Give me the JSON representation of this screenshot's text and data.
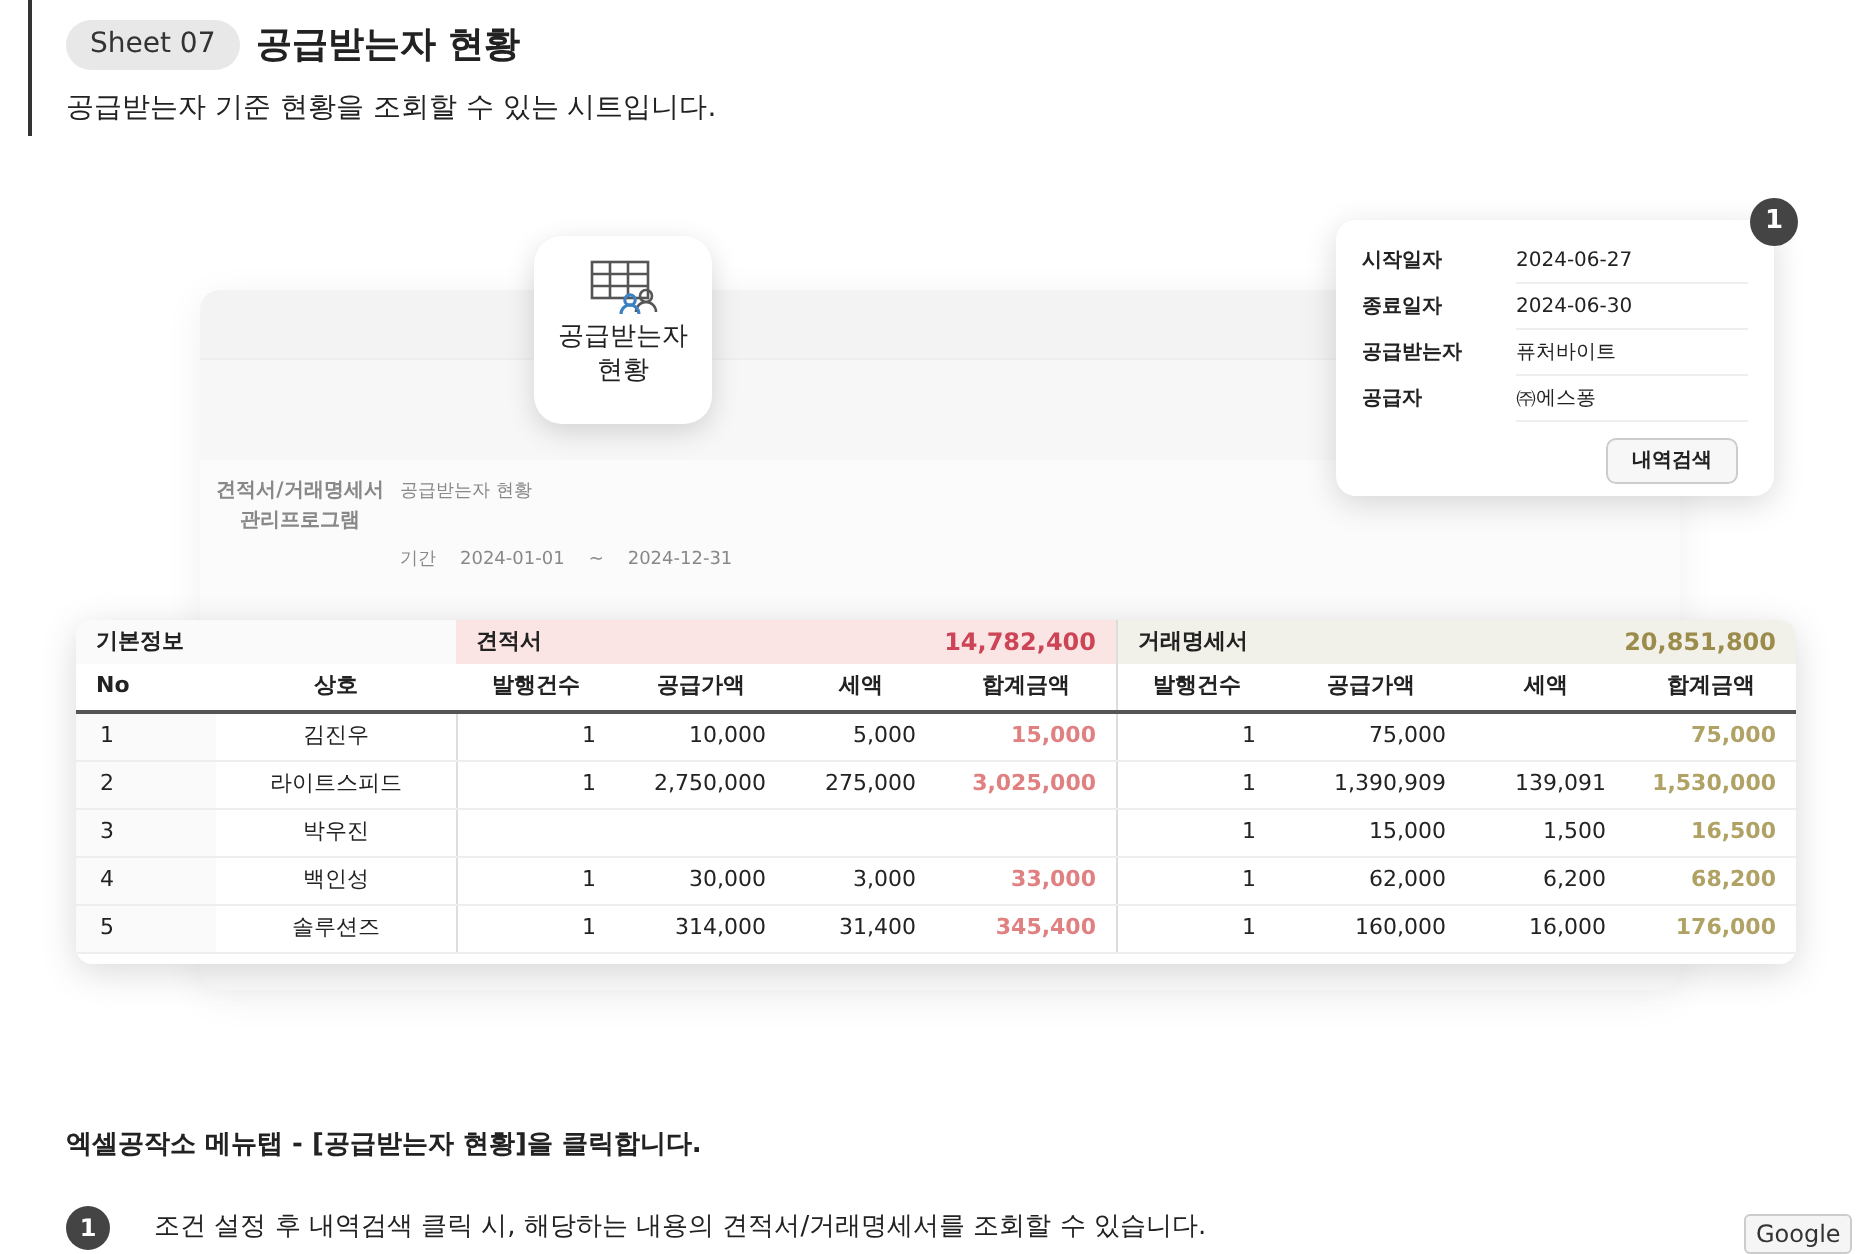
{
  "header": {
    "sheet_tag": "Sheet 07",
    "title": "공급받는자 현황",
    "subtitle": "공급받는자 기준 현황을 조회할 수 있는 시트입니다."
  },
  "backdrop_app": {
    "program_title": "견적서/거래명세서 관리프로그램",
    "sheet_title": "공급받는자 현황",
    "period_label": "기간",
    "period_from": "2024-01-01",
    "period_sep": "~",
    "period_to": "2024-12-31"
  },
  "menu_icon_card": {
    "label": "공급받는자 현황"
  },
  "filter_popup": {
    "badge": "1",
    "fields": [
      {
        "label": "시작일자",
        "value": "2024-06-27"
      },
      {
        "label": "종료일자",
        "value": "2024-06-30"
      },
      {
        "label": "공급받는자",
        "value": "퓨처바이트"
      },
      {
        "label": "공급자",
        "value": "㈜에스퐁"
      }
    ],
    "button": "내역검색"
  },
  "table": {
    "groups": [
      {
        "kind": "basic",
        "label": "기본정보"
      },
      {
        "kind": "quote",
        "label": "견적서",
        "total": "14,782,400"
      },
      {
        "kind": "statement",
        "label": "거래명세서",
        "total": "20,851,800"
      }
    ],
    "columns": [
      "No",
      "상호",
      "발행건수",
      "공급가액",
      "세액",
      "합계금액",
      "발행건수",
      "공급가액",
      "세액",
      "합계금액"
    ],
    "rows": [
      [
        "1",
        "김진우",
        "1",
        "10,000",
        "5,000",
        "15,000",
        "1",
        "75,000",
        "",
        "75,000"
      ],
      [
        "2",
        "라이트스피드",
        "1",
        "2,750,000",
        "275,000",
        "3,025,000",
        "1",
        "1,390,909",
        "139,091",
        "1,530,000"
      ],
      [
        "3",
        "박우진",
        "",
        "",
        "",
        "",
        "1",
        "15,000",
        "1,500",
        "16,500"
      ],
      [
        "4",
        "백인성",
        "1",
        "30,000",
        "3,000",
        "33,000",
        "1",
        "62,000",
        "6,200",
        "68,200"
      ],
      [
        "5",
        "솔루션즈",
        "1",
        "314,000",
        "31,400",
        "345,400",
        "1",
        "160,000",
        "16,000",
        "176,000"
      ]
    ]
  },
  "instruction": "엑셀공작소 메뉴탭 - [공급받는자 현황]을 클릭합니다.",
  "steps": [
    {
      "number": "1",
      "text": "조건 설정 후 내역검색 클릭 시, 해당하는 내용의 견적서/거래명세서를 조회할 수 있습니다."
    }
  ],
  "corner_button": "Google"
}
